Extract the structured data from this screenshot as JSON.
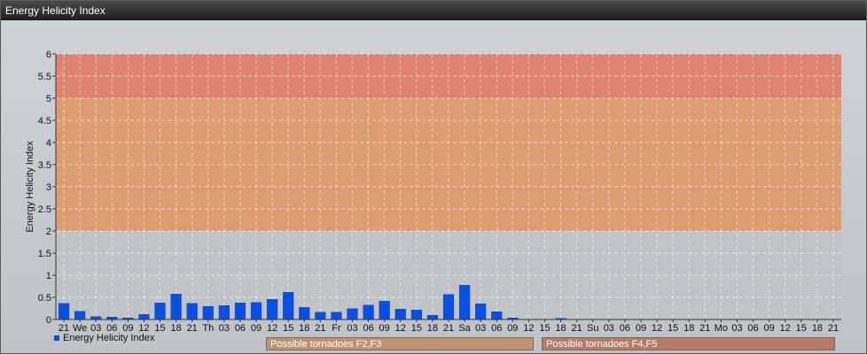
{
  "window": {
    "title": "Energy Helicity Index"
  },
  "chart_data": {
    "type": "bar",
    "title": "",
    "xlabel": "",
    "ylabel": "Energy Helicity Index",
    "ylim": [
      0,
      6
    ],
    "yticks": [
      0,
      0.5,
      1,
      1.5,
      2,
      2.5,
      3,
      3.5,
      4,
      4.5,
      5,
      5.5,
      6
    ],
    "grid": true,
    "legend": "bottom-left",
    "categories": [
      "21",
      "We",
      "03",
      "06",
      "09",
      "12",
      "15",
      "18",
      "21",
      "Th",
      "03",
      "06",
      "09",
      "12",
      "15",
      "18",
      "21",
      "Fr",
      "03",
      "06",
      "09",
      "12",
      "15",
      "18",
      "21",
      "Sa",
      "03",
      "06",
      "09",
      "12",
      "15",
      "18",
      "21",
      "Su",
      "03",
      "06",
      "09",
      "12",
      "15",
      "18",
      "21",
      "Mo",
      "03",
      "06",
      "09",
      "12",
      "15",
      "18",
      "21"
    ],
    "series": [
      {
        "name": "Energy Helicity Index",
        "color": "#0a4fe0",
        "values": [
          0.37,
          0.19,
          0.07,
          0.06,
          0.04,
          0.12,
          0.38,
          0.58,
          0.37,
          0.3,
          0.32,
          0.38,
          0.39,
          0.46,
          0.62,
          0.28,
          0.17,
          0.17,
          0.25,
          0.33,
          0.42,
          0.24,
          0.22,
          0.1,
          0.57,
          0.78,
          0.36,
          0.18,
          0.04,
          0.01,
          0.01,
          0.03,
          0.01,
          0.01,
          0.01,
          0.01,
          0.01,
          0.01,
          0.01,
          0.01,
          0.01,
          0.01,
          0.01,
          0.01,
          0.01,
          0.01,
          0.01,
          0.01,
          0.01
        ]
      }
    ],
    "bands": [
      {
        "from": 0,
        "to": 2,
        "color": "#c0c3c7",
        "label": ""
      },
      {
        "from": 2,
        "to": 5,
        "color": "#dc9e70",
        "label": "Possible tornadoes F2,F3"
      },
      {
        "from": 5,
        "to": 6,
        "color": "#de8470",
        "label": "Possible tornadoes F4,F5"
      }
    ]
  }
}
